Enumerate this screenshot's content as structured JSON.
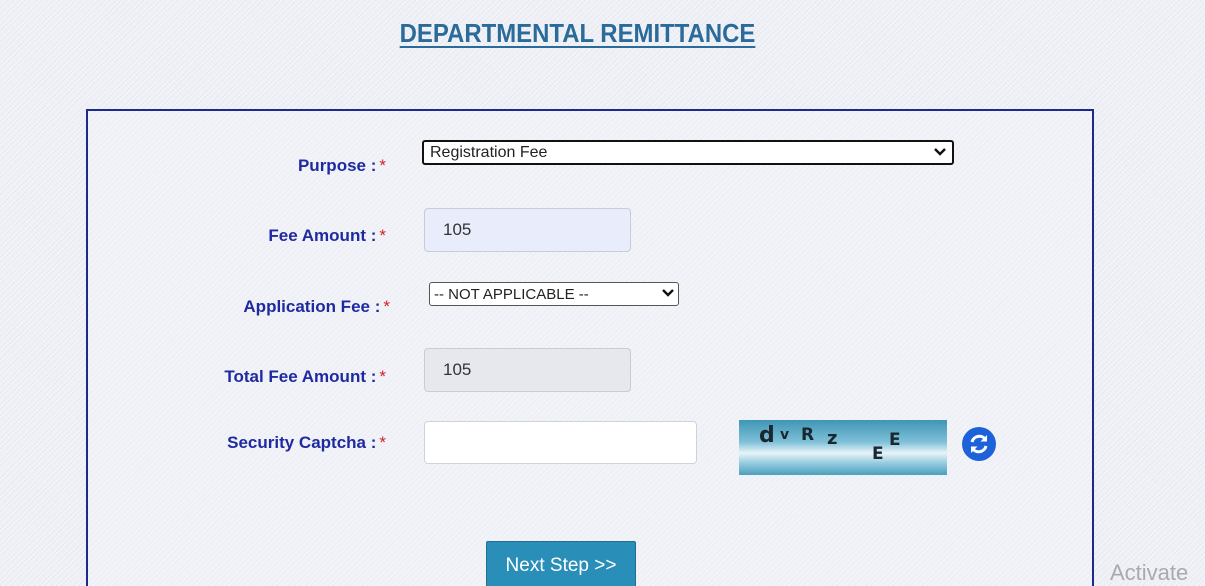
{
  "page": {
    "title": "DEPARTMENTAL REMITTANCE"
  },
  "form": {
    "required_marker": "*",
    "purpose": {
      "label": "Purpose :",
      "selected": "Registration Fee"
    },
    "fee_amount": {
      "label": "Fee Amount :",
      "value": "105"
    },
    "application_fee": {
      "label": "Application Fee :",
      "selected": "-- NOT APPLICABLE --"
    },
    "total_fee_amount": {
      "label": "Total Fee Amount :",
      "value": "105"
    },
    "security_captcha": {
      "label": "Security Captcha :",
      "value": "",
      "captcha_chars": [
        "d",
        "v",
        "R",
        "z",
        "E",
        "E"
      ]
    },
    "next_button": "Next Step >>"
  },
  "watermark": "Activate",
  "colors": {
    "title": "#2a6b9a",
    "label": "#1f2aa0",
    "required": "#d42020",
    "border": "#1c2a8a",
    "button": "#2a8fb8",
    "refresh": "#1d62d8"
  },
  "icons": {
    "refresh": "refresh-icon",
    "dropdown": "chevron-down-icon"
  }
}
